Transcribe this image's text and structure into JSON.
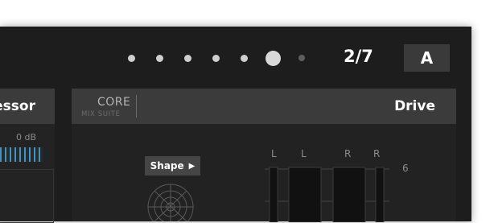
{
  "header": {
    "page_indicator": "2/7",
    "preset_label": "A",
    "dots": [
      {
        "state": "normal"
      },
      {
        "state": "normal"
      },
      {
        "state": "normal"
      },
      {
        "state": "normal"
      },
      {
        "state": "normal"
      },
      {
        "state": "active"
      },
      {
        "state": "dim"
      }
    ]
  },
  "left_panel": {
    "title": "Compressor",
    "db_label": "0 dB"
  },
  "drive_panel": {
    "brand_top": "CORE",
    "brand_bottom": "MIX SUITE",
    "title": "Drive",
    "shape_button": "Shape",
    "shape_arrow": "▶",
    "meter_labels": [
      "L",
      "L",
      "R",
      "R"
    ],
    "scale_label": "6"
  }
}
